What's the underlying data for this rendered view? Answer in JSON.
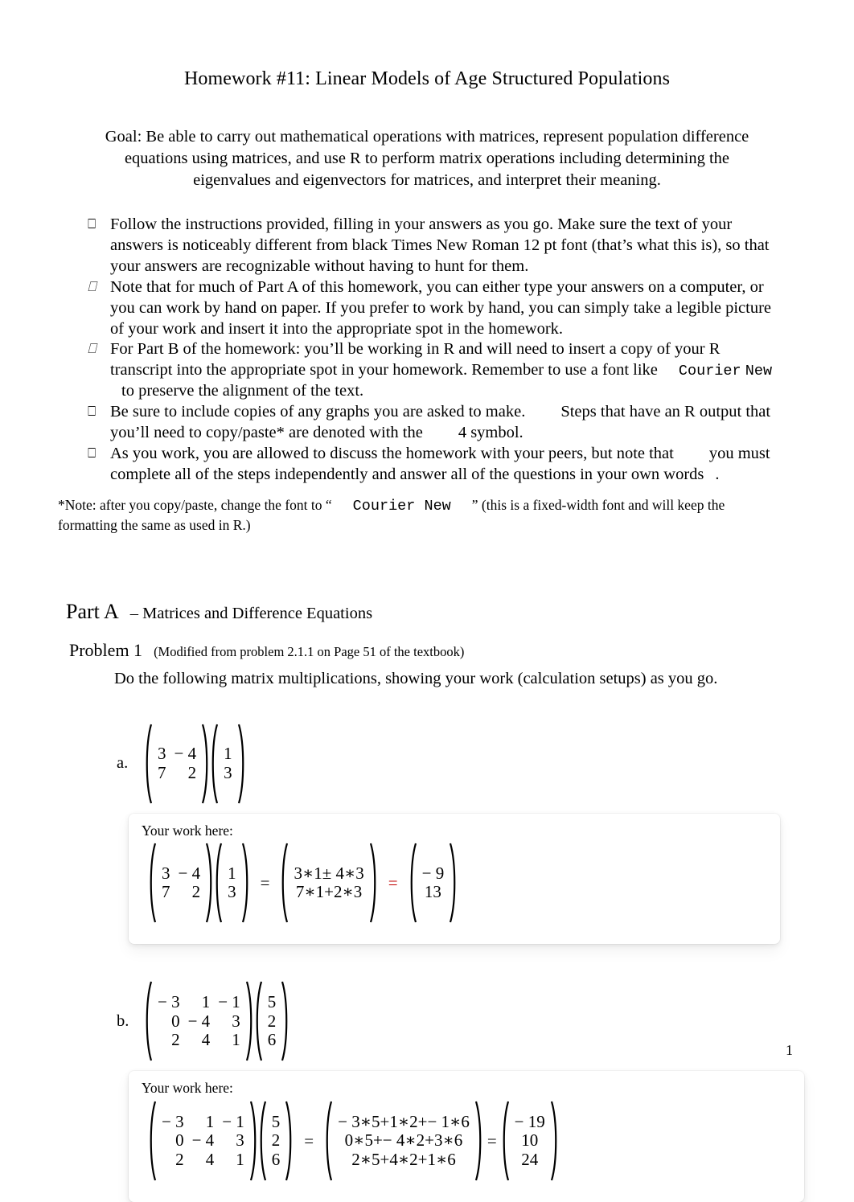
{
  "document": {
    "title": "Homework #11: Linear Models of Age Structured Populations",
    "goal": "Goal: Be able to carry out mathematical operations with matrices, represent population difference equations using matrices, and use R to perform matrix operations including determining the eigenvalues and eigenvectors for matrices, and interpret their meaning.",
    "page_number": "1"
  },
  "instructions": {
    "bullet_glyph": "⎕",
    "items": [
      {
        "marker": "⎕",
        "marker_style": "box",
        "text": "Follow the instructions provided, filling in your answers as you go. Make sure the text of your answers is noticeably different from black Times New Roman 12 pt font (that’s what this is), so that your answers are recognizable without having to hunt for them."
      },
      {
        "marker": "⎕",
        "marker_style": "box-italic",
        "text": "Note that for much of Part A  of this homework, you can either type your answers on a computer, or you can work by hand on paper. If you prefer to work by hand, you can simply take a legible picture of your work and insert it into the appropriate spot in the homework."
      },
      {
        "marker": "⎕",
        "marker_style": "box-italic",
        "text_pre": "For Part B of the homework: you’ll be working in R and will need to insert a copy of your R transcript into the appropriate spot in your homework. Remember to use a font like",
        "mono_1": "Courier",
        "mono_2": "New",
        "text_post": "to preserve the alignment of the text."
      },
      {
        "marker": "⎕",
        "marker_style": "box",
        "text_pre": "Be sure to include copies of any graphs you are asked to make.",
        "text_mid": "Steps that have an R output that you’ll need to copy/paste* are denoted with the",
        "symbol": "4",
        "text_post": "symbol."
      },
      {
        "marker": "⎕",
        "marker_style": "box",
        "text_pre": "As you work, you are allowed to discuss the homework with your peers, but note that",
        "text_post": "you must complete all of the steps independently and answer all of the questions in your",
        "emphasis": "own words",
        "text_end": "."
      }
    ],
    "footnote_pre": "*Note: after you copy/paste, change the font to “",
    "footnote_mono": "Courier New",
    "footnote_post": "” (this is a fixed-width font and will keep the formatting the same as used in R.)"
  },
  "part_a": {
    "label": "Part A",
    "subtitle": "– Matrices and Difference Equations",
    "problem": {
      "label": "Problem 1",
      "note": "(Modified from problem 2.1.1 on Page 51 of the textbook)",
      "prompt": "Do the following matrix multiplications, showing your work (calculation setups) as you go.",
      "work_label": "Your work here:",
      "items": [
        {
          "letter": "a.",
          "matrix_a": {
            "rows": 2,
            "cols": 2,
            "cells": [
              "3",
              "− 4",
              "7",
              "2"
            ]
          },
          "vector_b": {
            "rows": 2,
            "cols": 1,
            "cells": [
              "1",
              "3"
            ]
          },
          "work": {
            "eq1": "=",
            "setup": {
              "rows": 2,
              "cols": 1,
              "cells": [
                "3∗1± 4∗3",
                "7∗1+2∗3"
              ]
            },
            "eq2": "=",
            "eq2_color": "#c00000",
            "result": {
              "rows": 2,
              "cols": 1,
              "cells": [
                "− 9",
                "13"
              ]
            }
          }
        },
        {
          "letter": "b.",
          "matrix_a": {
            "rows": 3,
            "cols": 3,
            "cells": [
              "− 3",
              "1",
              "− 1",
              "0",
              "− 4",
              "3",
              "2",
              "4",
              "1"
            ]
          },
          "vector_b": {
            "rows": 3,
            "cols": 1,
            "cells": [
              "5",
              "2",
              "6"
            ]
          },
          "work": {
            "eq1": "=",
            "setup": {
              "rows": 3,
              "cols": 1,
              "cells": [
                "− 3∗5+1∗2+− 1∗6",
                "0∗5+− 4∗2+3∗6",
                "2∗5+4∗2+1∗6"
              ]
            },
            "eq2": "=",
            "eq2_color": "#000000",
            "result": {
              "rows": 3,
              "cols": 1,
              "cells": [
                "− 19",
                "10",
                "24"
              ]
            }
          }
        }
      ]
    }
  }
}
